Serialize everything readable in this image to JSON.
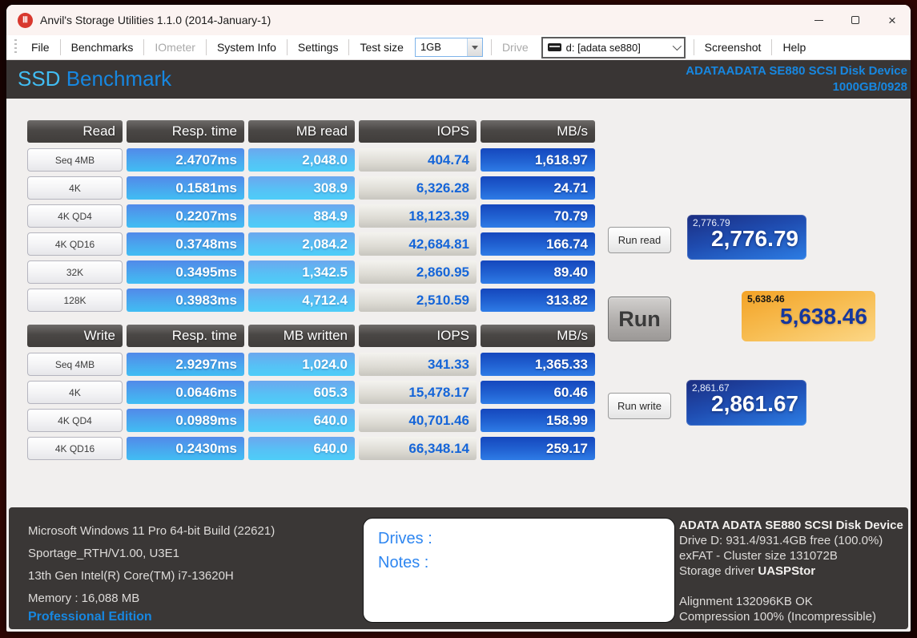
{
  "window": {
    "title": "Anvil's Storage Utilities 1.1.0 (2014-January-1)"
  },
  "icons": {
    "app": "bank-columns",
    "close": "×"
  },
  "menu": {
    "file": "File",
    "benchmarks": "Benchmarks",
    "iometer": "IOmeter",
    "system_info": "System Info",
    "settings": "Settings",
    "test_size_label": "Test size",
    "test_size_value": "1GB",
    "drive_label": "Drive",
    "drive_value": "d: [adata se880]",
    "screenshot": "Screenshot",
    "help": "Help"
  },
  "header": {
    "title_ssd": "SSD ",
    "title_benchmark": "Benchmark",
    "device_line1": "ADATAADATA SE880 SCSI Disk Device",
    "device_line2": "1000GB/0928"
  },
  "read": {
    "headers": [
      "Read",
      "Resp. time",
      "MB read",
      "IOPS",
      "MB/s"
    ],
    "rows": [
      [
        "Seq 4MB",
        "2.4707ms",
        "2,048.0",
        "404.74",
        "1,618.97"
      ],
      [
        "4K",
        "0.1581ms",
        "308.9",
        "6,326.28",
        "24.71"
      ],
      [
        "4K QD4",
        "0.2207ms",
        "884.9",
        "18,123.39",
        "70.79"
      ],
      [
        "4K QD16",
        "0.3748ms",
        "2,084.2",
        "42,684.81",
        "166.74"
      ],
      [
        "32K",
        "0.3495ms",
        "1,342.5",
        "2,860.95",
        "89.40"
      ],
      [
        "128K",
        "0.3983ms",
        "4,712.4",
        "2,510.59",
        "313.82"
      ]
    ]
  },
  "write": {
    "headers": [
      "Write",
      "Resp. time",
      "MB written",
      "IOPS",
      "MB/s"
    ],
    "rows": [
      [
        "Seq 4MB",
        "2.9297ms",
        "1,024.0",
        "341.33",
        "1,365.33"
      ],
      [
        "4K",
        "0.0646ms",
        "605.3",
        "15,478.17",
        "60.46"
      ],
      [
        "4K QD4",
        "0.0989ms",
        "640.0",
        "40,701.46",
        "158.99"
      ],
      [
        "4K QD16",
        "0.2430ms",
        "640.0",
        "66,348.14",
        "259.17"
      ]
    ]
  },
  "actions": {
    "run_read": "Run read",
    "run": "Run",
    "run_write": "Run write"
  },
  "scores": {
    "read": {
      "small": "2,776.79",
      "big": "2,776.79"
    },
    "total": {
      "small": "5,638.46",
      "big": "5,638.46"
    },
    "write": {
      "small": "2,861.67",
      "big": "2,861.67"
    }
  },
  "footer": {
    "system": [
      "Microsoft Windows 11 Pro 64-bit Build (22621)",
      "Sportage_RTH/V1.00, U3E1",
      "13th Gen Intel(R) Core(TM) i7-13620H",
      "Memory : 16,088 MB"
    ],
    "edition": "Professional Edition",
    "notes": {
      "drives_label": "Drives :",
      "notes_label": "Notes :"
    },
    "device": {
      "title": "ADATA ADATA SE880 SCSI Disk Device",
      "line1": "Drive D: 931.4/931.4GB free (100.0%)",
      "line2": "exFAT - Cluster size 131072B",
      "driver_prefix": "Storage driver ",
      "driver_name": "UASPStor",
      "alignment": "Alignment 132096KB OK",
      "compression": "Compression 100% (Incompressible)"
    }
  },
  "colors": {
    "accent_blue": "#1787e0",
    "accent_cyan": "#41bdf3",
    "score_orange": "#f3a226",
    "header_dark": "#393534",
    "footer_dark": "#3a3736",
    "titlebar": "#fbf3f1",
    "iops_text": "#1565d8"
  }
}
